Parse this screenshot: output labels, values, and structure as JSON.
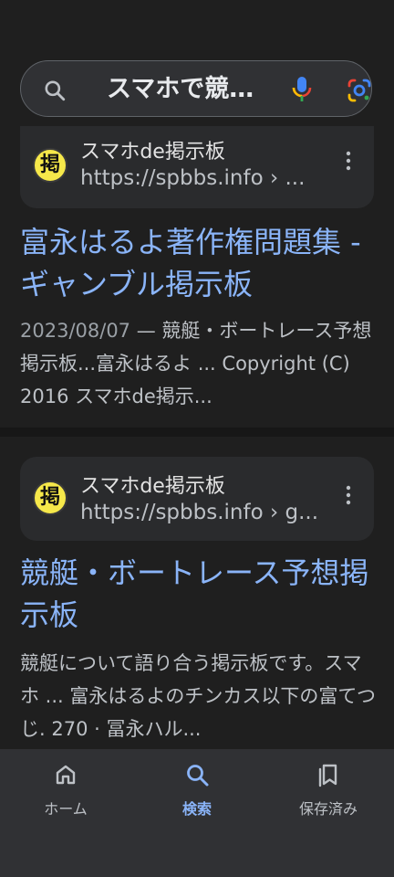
{
  "search": {
    "query": "スマホで競…",
    "icons": {
      "search": "search-icon",
      "mic": "microphone-icon",
      "lens": "google-lens-icon"
    }
  },
  "results": [
    {
      "site_name": "スマホde掲示板",
      "url": "https://spbbs.info › ...",
      "favicon_char": "掲",
      "title": "富永はるよ著作権問題集 - ギャンブル掲示板",
      "date": "2023/08/07",
      "snippet": " — 競艇・ボートレース予想掲示板...富永はるよ ... Copyright (C) 2016 スマホde掲示..."
    },
    {
      "site_name": "スマホde掲示板",
      "url": "https://spbbs.info › g...",
      "favicon_char": "掲",
      "title": "競艇・ボートレース予想掲示板",
      "date": "",
      "snippet": "競艇について語り合う掲示板です。スマホ ... 富永はるよのチンカス以下の富てつじ. 270 · 冨永ハル..."
    }
  ],
  "bottom_nav": {
    "items": [
      {
        "label": "ホーム",
        "icon": "home-icon",
        "active": false
      },
      {
        "label": "検索",
        "icon": "search-icon",
        "active": true
      },
      {
        "label": "保存済み",
        "icon": "saved-icon",
        "active": false
      }
    ]
  },
  "colors": {
    "background": "#1f1f1f",
    "link": "#8ab4f8",
    "text": "#e3e3e3",
    "muted": "#bdc1c6",
    "favicon": "#f6e84a"
  }
}
